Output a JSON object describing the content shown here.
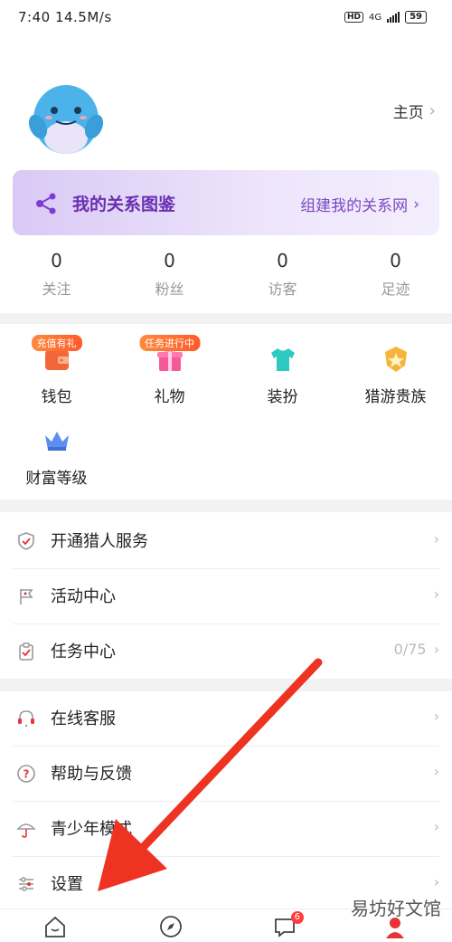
{
  "status": {
    "time_and_speed": "7:40 14.5M/s",
    "network": "4G",
    "battery": "59"
  },
  "profile": {
    "home_label": "主页"
  },
  "banner": {
    "title": "我的关系图鉴",
    "link": "组建我的关系网"
  },
  "stats": [
    {
      "value": "0",
      "label": "关注"
    },
    {
      "value": "0",
      "label": "粉丝"
    },
    {
      "value": "0",
      "label": "访客"
    },
    {
      "value": "0",
      "label": "足迹"
    }
  ],
  "grid": [
    {
      "label": "钱包",
      "badge": "充值有礼"
    },
    {
      "label": "礼物",
      "badge": "任务进行中"
    },
    {
      "label": "装扮"
    },
    {
      "label": "猎游贵族"
    },
    {
      "label": "财富等级"
    }
  ],
  "list": [
    {
      "label": "开通猎人服务"
    },
    {
      "label": "活动中心"
    },
    {
      "label": "任务中心",
      "value": "0/75"
    },
    {
      "label": "在线客服"
    },
    {
      "label": "帮助与反馈"
    },
    {
      "label": "青少年模式"
    },
    {
      "label": "设置"
    }
  ],
  "tabbar": {
    "messages_badge": "6"
  },
  "watermark": "易坊好文馆",
  "colors": {
    "accent_purple": "#6a2fb0",
    "badge_orange": "#ff6a2a",
    "arrow_red": "#ee3322"
  }
}
